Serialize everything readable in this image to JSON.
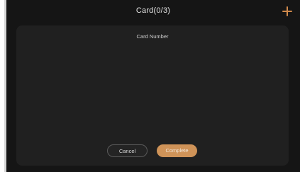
{
  "header": {
    "title": "Card(0/3)",
    "add_icon": "plus-icon",
    "accent_color": "#d08a4c"
  },
  "panel": {
    "label": "Card Number"
  },
  "actions": {
    "cancel_label": "Cancel",
    "complete_label": "Complete"
  }
}
